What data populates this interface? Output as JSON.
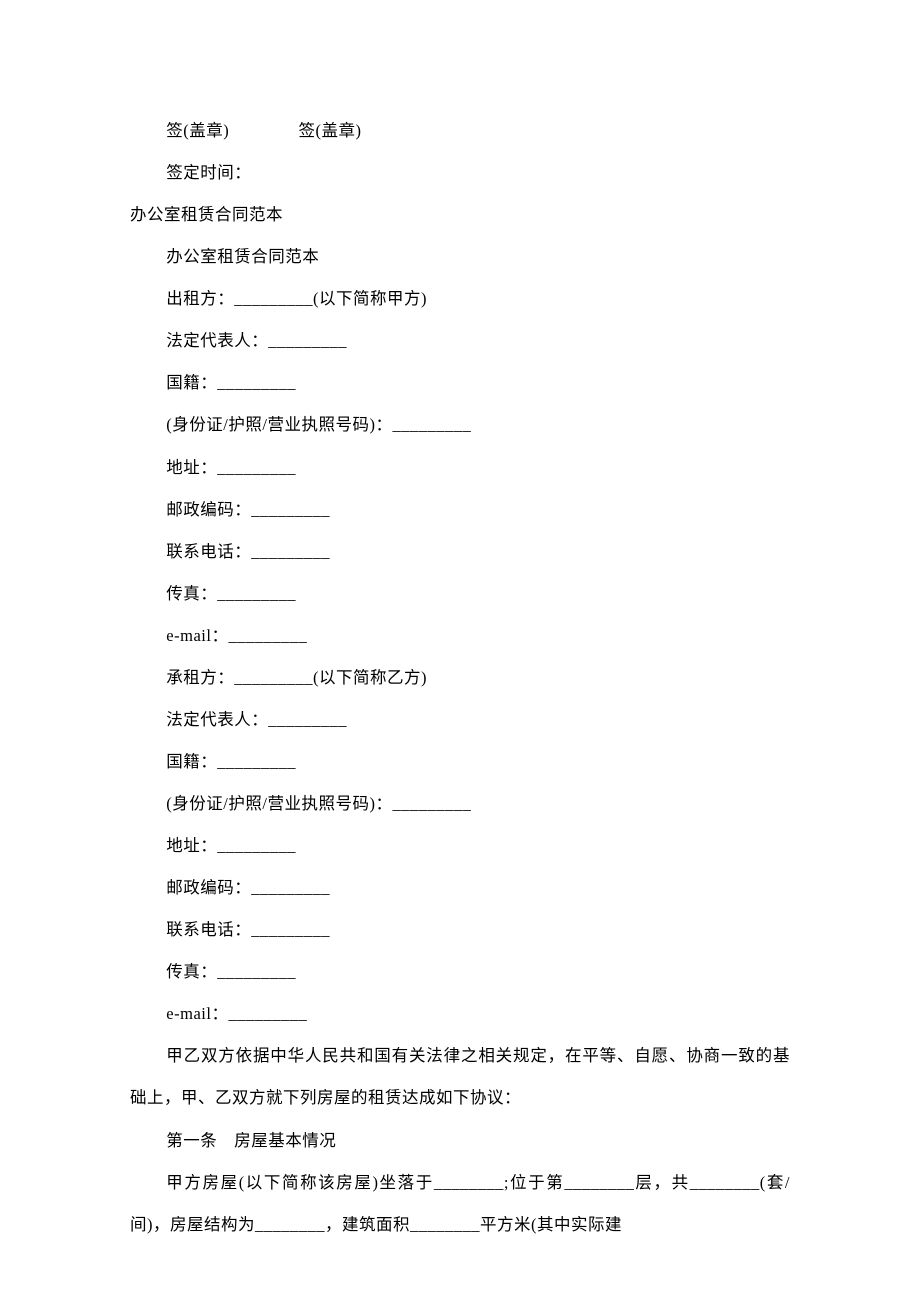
{
  "sig1": "签(盖章)",
  "sig2": "签(盖章)",
  "sigtime": "签定时间：",
  "title1": "办公室租赁合同范本",
  "title2": "办公室租赁合同范本",
  "partyA": {
    "lessor": "出租方：_________(以下简称甲方)",
    "rep": "法定代表人：_________",
    "nat": "国籍：_________",
    "id": "(身份证/护照/营业执照号码)：_________",
    "addr": "地址：_________",
    "zip": "邮政编码：_________",
    "tel": "联系电话：_________",
    "fax": "传真：_________",
    "email": "e-mail：_________"
  },
  "partyB": {
    "lessee": "承租方：_________(以下简称乙方)",
    "rep": "法定代表人：_________",
    "nat": "国籍：_________",
    "id": "(身份证/护照/营业执照号码)：_________",
    "addr": "地址：_________",
    "zip": "邮政编码：_________",
    "tel": "联系电话：_________",
    "fax": "传真：_________",
    "email": "e-mail：_________"
  },
  "preamble": "甲乙双方依据中华人民共和国有关法律之相关规定，在平等、自愿、协商一致的基础上，甲、乙双方就下列房屋的租赁达成如下协议：",
  "article1_title": "第一条　房屋基本情况",
  "article1_body": "甲方房屋(以下简称该房屋)坐落于________;位于第________层，共________(套/间)，房屋结构为________，建筑面积________平方米(其中实际建"
}
